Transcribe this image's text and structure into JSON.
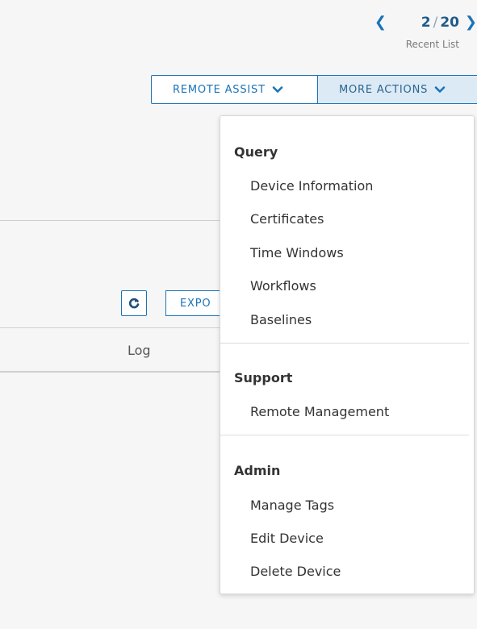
{
  "pager": {
    "current": "2",
    "separator": "/",
    "total": "20",
    "label": "Recent List"
  },
  "actions": {
    "remote_assist": "REMOTE ASSIST",
    "more_actions": "MORE ACTIONS"
  },
  "toolbar": {
    "export_label": "EXPO"
  },
  "table": {
    "columns": [
      "Log"
    ]
  },
  "menu": {
    "sections": [
      {
        "title": "Query",
        "items": [
          "Device Information",
          "Certificates",
          "Time Windows",
          "Workflows",
          "Baselines"
        ]
      },
      {
        "title": "Support",
        "items": [
          "Remote Management"
        ]
      },
      {
        "title": "Admin",
        "items": [
          "Manage Tags",
          "Edit Device",
          "Delete Device"
        ]
      }
    ]
  },
  "colors": {
    "accent": "#1a73b8",
    "active_button_bg": "#dceaf5",
    "page_bg": "#f6f6f6"
  }
}
